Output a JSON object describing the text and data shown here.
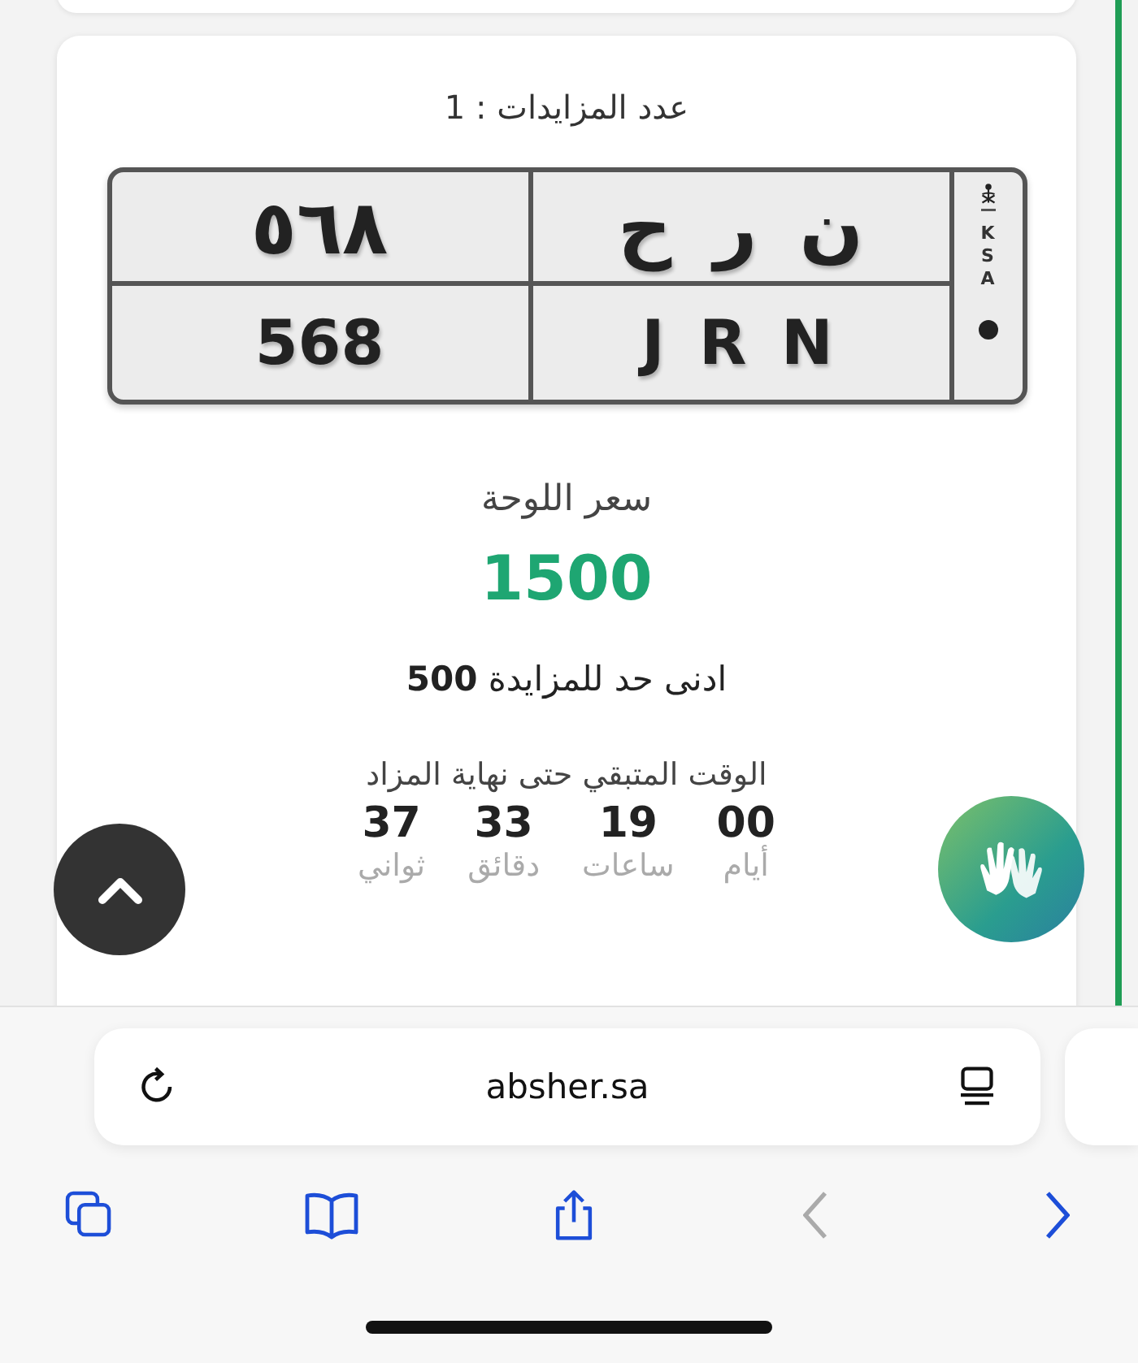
{
  "auction": {
    "bids_label": "عدد المزايدات : 1",
    "plate": {
      "arabic_digits": "٥٦٨",
      "arabic_letters": "ن ر ح",
      "latin_digits": "568",
      "latin_letters": "J R N",
      "country": [
        "K",
        "S",
        "A"
      ]
    },
    "price_label": "سعر اللوحة",
    "price": "1500",
    "min_bid": "ادنى حد للمزايدة **500**",
    "countdown_label": "الوقت المتبقي حتى نهاية المزاد",
    "countdown": [
      {
        "value": "00",
        "unit": "أيام"
      },
      {
        "value": "19",
        "unit": "ساعات"
      },
      {
        "value": "33",
        "unit": "دقائق"
      },
      {
        "value": "37",
        "unit": "ثواني"
      }
    ]
  },
  "browser": {
    "url": "absher.sa",
    "toolbar": [
      {
        "kind": "tabs",
        "disabled": false
      },
      {
        "kind": "bookmarks",
        "disabled": false
      },
      {
        "kind": "share",
        "disabled": false
      },
      {
        "kind": "back",
        "disabled": true
      },
      {
        "kind": "forward",
        "disabled": false
      }
    ]
  }
}
